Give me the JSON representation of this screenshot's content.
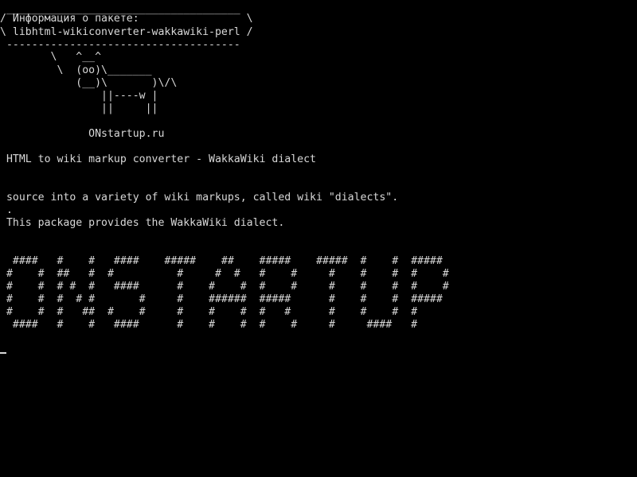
{
  "terminal": {
    "background": "#000000",
    "foreground": "#d8d8d8",
    "cowsay": {
      "bubble_top": " _____________________________________ ",
      "bubble_line1": "/ Информация о пакете:                 \\",
      "bubble_line2": "\\ libhtml-wikiconverter-wakkawiki-perl /",
      "bubble_bottom": " ------------------------------------- ",
      "cow_line1": "        \\   ^__^",
      "cow_line2": "         \\  (oo)\\_______",
      "cow_line3": "            (__)\\       )\\/\\",
      "cow_line4": "                ||----w |",
      "cow_line5": "                ||     ||",
      "site": "              ONstartup.ru"
    },
    "description": {
      "summary": " HTML to wiki markup converter - WakkaWiki dialect",
      "line1": " source into a variety of wiki markups, called wiki \"dialects\".",
      "line2": " .",
      "line3": " This package provides the WakkaWiki dialect."
    },
    "banner": [
      "  ####   #    #   ####    #####    ##    #####    #####  #    #  #####",
      " #    #  ##   #  #          #     #  #   #    #     #    #    #  #    #",
      " #    #  # #  #   ####      #    #    #  #    #     #    #    #  #    #",
      " #    #  #  # #       #     #    ######  #####      #    #    #  #####",
      " #    #  #   ##  #    #     #    #    #  #   #      #    #    #  #",
      "  ####   #    #   ####      #    #    #  #    #     #     ####   #"
    ]
  }
}
